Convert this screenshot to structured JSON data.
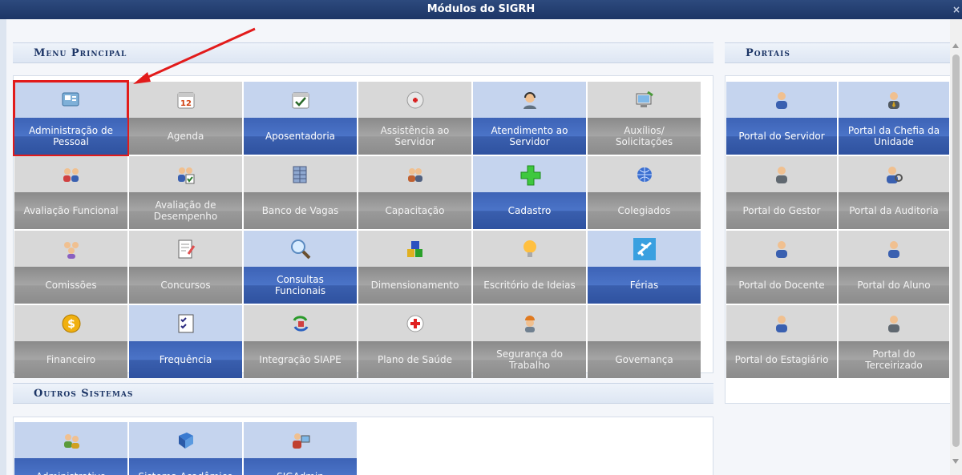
{
  "window": {
    "title": "Módulos do SIGRH",
    "close_label": "×"
  },
  "sections": {
    "menu_principal": "Menu Principal",
    "portais": "Portais",
    "outros_sistemas": "Outros Sistemas"
  },
  "menu_tiles": [
    {
      "label": "Administração de\nPessoal",
      "icon": "admin-pessoal-icon",
      "active": true,
      "highlight": true
    },
    {
      "label": "Agenda",
      "icon": "calendar-icon",
      "active": false
    },
    {
      "label": "Aposentadoria",
      "icon": "calendar-check-icon",
      "active": true
    },
    {
      "label": "Assistência ao\nServidor",
      "icon": "first-aid-icon",
      "active": false
    },
    {
      "label": "Atendimento ao\nServidor",
      "icon": "headset-user-icon",
      "active": true
    },
    {
      "label": "Auxílios/\nSolicitações",
      "icon": "computer-icon",
      "active": false
    },
    {
      "label": "Avaliação Funcional",
      "icon": "users-pair-icon",
      "active": false
    },
    {
      "label": "Avaliação de\nDesempenho",
      "icon": "users-check-icon",
      "active": false
    },
    {
      "label": "Banco de Vagas",
      "icon": "database-icon",
      "active": false
    },
    {
      "label": "Capacitação",
      "icon": "users-group-icon",
      "active": false
    },
    {
      "label": "Cadastro",
      "icon": "plus-icon",
      "active": true
    },
    {
      "label": "Colegiados",
      "icon": "globe-icon",
      "active": false
    },
    {
      "label": "Comissões",
      "icon": "committee-icon",
      "active": false
    },
    {
      "label": "Concursos",
      "icon": "document-edit-icon",
      "active": false
    },
    {
      "label": "Consultas\nFuncionais",
      "icon": "magnifier-icon",
      "active": true
    },
    {
      "label": "Dimensionamento",
      "icon": "blocks-icon",
      "active": false
    },
    {
      "label": "Escritório de Ideias",
      "icon": "lightbulb-icon",
      "active": false
    },
    {
      "label": "Férias",
      "icon": "airplane-icon",
      "active": true
    },
    {
      "label": "Financeiro",
      "icon": "dollar-coin-icon",
      "active": false
    },
    {
      "label": "Frequência",
      "icon": "checklist-icon",
      "active": true
    },
    {
      "label": "Integração SIAPE",
      "icon": "sync-icon",
      "active": false
    },
    {
      "label": "Plano de Saúde",
      "icon": "red-cross-icon",
      "active": false
    },
    {
      "label": "Segurança do\nTrabalho",
      "icon": "hardhat-worker-icon",
      "active": false
    },
    {
      "label": "Governança",
      "icon": "",
      "active": false
    }
  ],
  "portal_tiles": [
    {
      "label": "Portal do Servidor",
      "icon": "user-blue-icon",
      "active": true
    },
    {
      "label": "Portal da Chefia da\nUnidade",
      "icon": "user-tie-icon",
      "active": true
    },
    {
      "label": "Portal do Gestor",
      "icon": "user-gray-icon",
      "active": false
    },
    {
      "label": "Portal da Auditoria",
      "icon": "user-magnifier-icon",
      "active": false
    },
    {
      "label": "Portal do Docente",
      "icon": "user-blue-icon",
      "active": false
    },
    {
      "label": "Portal do Aluno",
      "icon": "user-blue-icon",
      "active": false
    },
    {
      "label": "Portal do Estagiário",
      "icon": "user-blue-icon",
      "active": false
    },
    {
      "label": "Portal do\nTerceirizado",
      "icon": "user-gray-icon",
      "active": false
    }
  ],
  "outros_tiles": [
    {
      "label": "Administrativo",
      "icon": "admin-users-icon",
      "active": true
    },
    {
      "label": "Sistema Acadêmico",
      "icon": "book-icon",
      "active": true
    },
    {
      "label": "SIGAdmin",
      "icon": "user-computer-icon",
      "active": true
    }
  ],
  "colors": {
    "titlebar": "#1c3566",
    "active_tile": "#3a5fae",
    "inactive_tile": "#9a9a9a",
    "highlight": "#e21b1b"
  }
}
